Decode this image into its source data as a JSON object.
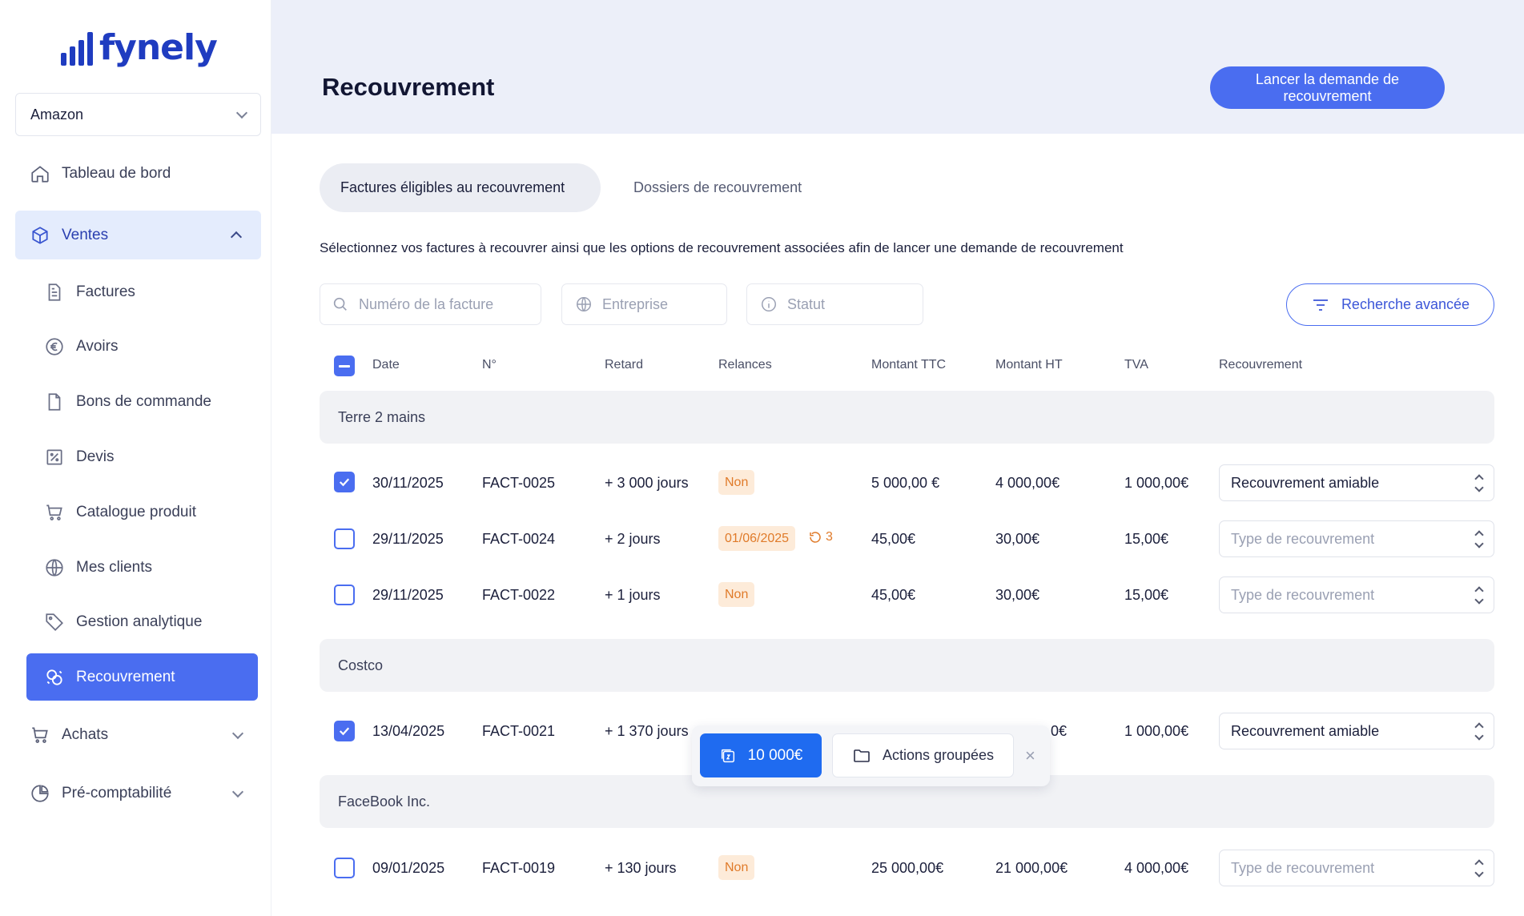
{
  "brand": {
    "name": "fynely",
    "accent": "#4a6df0",
    "logo_color": "#1f3cc0"
  },
  "sidebar": {
    "company": "Amazon",
    "items": [
      {
        "label": "Tableau de bord",
        "icon": "home-icon"
      },
      {
        "label": "Ventes",
        "icon": "package-icon"
      },
      {
        "label": "Factures",
        "icon": "document-icon"
      },
      {
        "label": "Avoirs",
        "icon": "euro-icon"
      },
      {
        "label": "Bons de commande",
        "icon": "file-icon"
      },
      {
        "label": "Devis",
        "icon": "percent-icon"
      },
      {
        "label": "Catalogue produit",
        "icon": "cart-icon"
      },
      {
        "label": "Mes clients",
        "icon": "globe-icon"
      },
      {
        "label": "Gestion analytique",
        "icon": "tag-icon"
      },
      {
        "label": "Recouvrement",
        "icon": "recovery-icon"
      },
      {
        "label": "Achats",
        "icon": "cart-icon"
      },
      {
        "label": "Pré-comptabilité",
        "icon": "pie-chart-icon"
      }
    ]
  },
  "header": {
    "title": "Recouvrement",
    "launch_button": "Lancer la demande de recouvrement"
  },
  "tabs": [
    "Factures éligibles au recouvrement",
    "Dossiers de recouvrement"
  ],
  "description": "Sélectionnez vos factures à recouvrer ainsi que les options de recouvrement associées afin de lancer une demande de recouvrement",
  "filters": {
    "invoice_placeholder": "Numéro de la facture",
    "company_placeholder": "Entreprise",
    "status_placeholder": "Statut",
    "advanced_search": "Recherche avancée"
  },
  "table": {
    "columns": [
      "Date",
      "N°",
      "Retard",
      "Relances",
      "Montant TTC",
      "Montant HT",
      "TVA",
      "Recouvrement"
    ],
    "groups": [
      "Terre 2 mains",
      "Costco",
      "FaceBook Inc."
    ],
    "rows": [
      {
        "date": "30/11/2025",
        "num": "FACT-0025",
        "retard": "+ 3 000 jours",
        "relance": "Non",
        "ttc": "5 000,00 €",
        "ht": "4 000,00€",
        "tva": "1 000,00€",
        "recouvrement": "Recouvrement amiable"
      },
      {
        "date": "29/11/2025",
        "num": "FACT-0024",
        "retard": "+ 2 jours",
        "relance": "01/06/2025",
        "relance_count": "3",
        "ttc": "45,00€",
        "ht": "30,00€",
        "tva": "15,00€",
        "recouvrement": "Type de recouvrement"
      },
      {
        "date": "29/11/2025",
        "num": "FACT-0022",
        "retard": "+ 1 jours",
        "relance": "Non",
        "ttc": "45,00€",
        "ht": "30,00€",
        "tva": "15,00€",
        "recouvrement": "Type de recouvrement"
      },
      {
        "date": "13/04/2025",
        "num": "FACT-0021",
        "retard": "+ 1 370 jours",
        "ht_partial": "0€",
        "tva": "1 000,00€",
        "recouvrement": "Recouvrement amiable"
      },
      {
        "date": "09/01/2025",
        "num": "FACT-0019",
        "retard": "+ 130 jours",
        "relance": "Non",
        "ttc": "25 000,00€",
        "ht": "21 000,00€",
        "tva": "4 000,00€",
        "recouvrement": "Type de recouvrement"
      }
    ]
  },
  "action_bar": {
    "amount": "10 000€",
    "group_actions": "Actions groupées",
    "close": "×"
  }
}
